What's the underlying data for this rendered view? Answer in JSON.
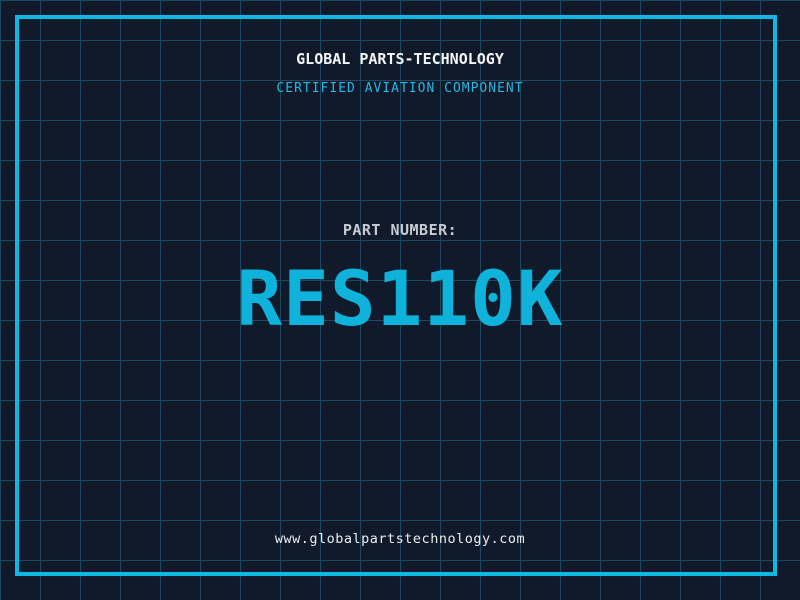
{
  "label": {
    "company": "GLOBAL PARTS-TECHNOLOGY",
    "subtitle": "CERTIFIED AVIATION COMPONENT",
    "part_label": "PART NUMBER:",
    "part_number": "RES110K",
    "website": "www.globalpartstechnology.com"
  },
  "colors": {
    "background": "#101a2a",
    "grid_line": "#1b4a5e",
    "frame_border": "#0db8e2",
    "company_text": "#f5f7f7",
    "subtitle_text": "#2ab4e4",
    "part_label_text": "#c7ccd4",
    "part_number_text": "#0eb2da",
    "website_text": "#e9eef0"
  }
}
